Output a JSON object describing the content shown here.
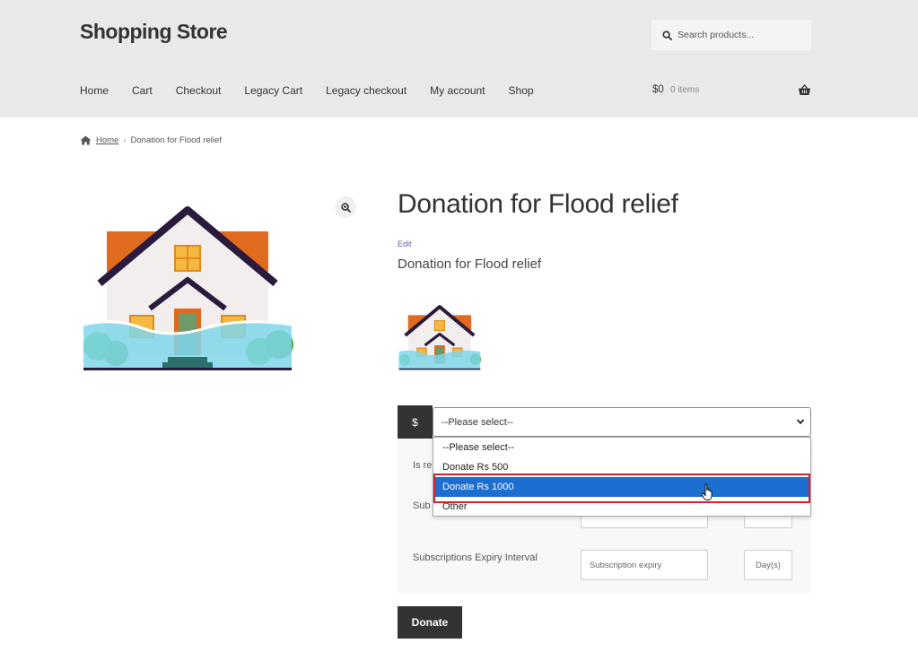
{
  "header": {
    "site_title": "Shopping Store",
    "search_placeholder": "Search products...",
    "nav": [
      "Home",
      "Cart",
      "Checkout",
      "Legacy Cart",
      "Legacy checkout",
      "My account",
      "Shop"
    ],
    "cart_total": "$0",
    "cart_count": "0 items"
  },
  "breadcrumb": {
    "home": "Home",
    "current": "Donation for Flood relief"
  },
  "product": {
    "title": "Donation for Flood relief",
    "edit_label": "Edit",
    "short_description": "Donation for Flood relief"
  },
  "donation": {
    "currency_symbol": "$",
    "selected_value": "--Please select--",
    "options": [
      "--Please select--",
      "Donate Rs 500",
      "Donate Rs 1000",
      "Other"
    ],
    "highlighted_option": "Donate Rs 1000"
  },
  "options_panel": {
    "recurring_label_partial": "Is re",
    "subscription_label_partial": "Sub",
    "expiry_label": "Subscriptions Expiry Interval",
    "expiry_placeholder": "Subscription expiry",
    "expiry_unit": "Day(s)"
  },
  "donate_button": "Donate",
  "colors": {
    "header_bg": "#e9e9e9",
    "dark": "#333333",
    "selected_blue": "#1c6fd1",
    "highlight_red": "#d4202f"
  }
}
